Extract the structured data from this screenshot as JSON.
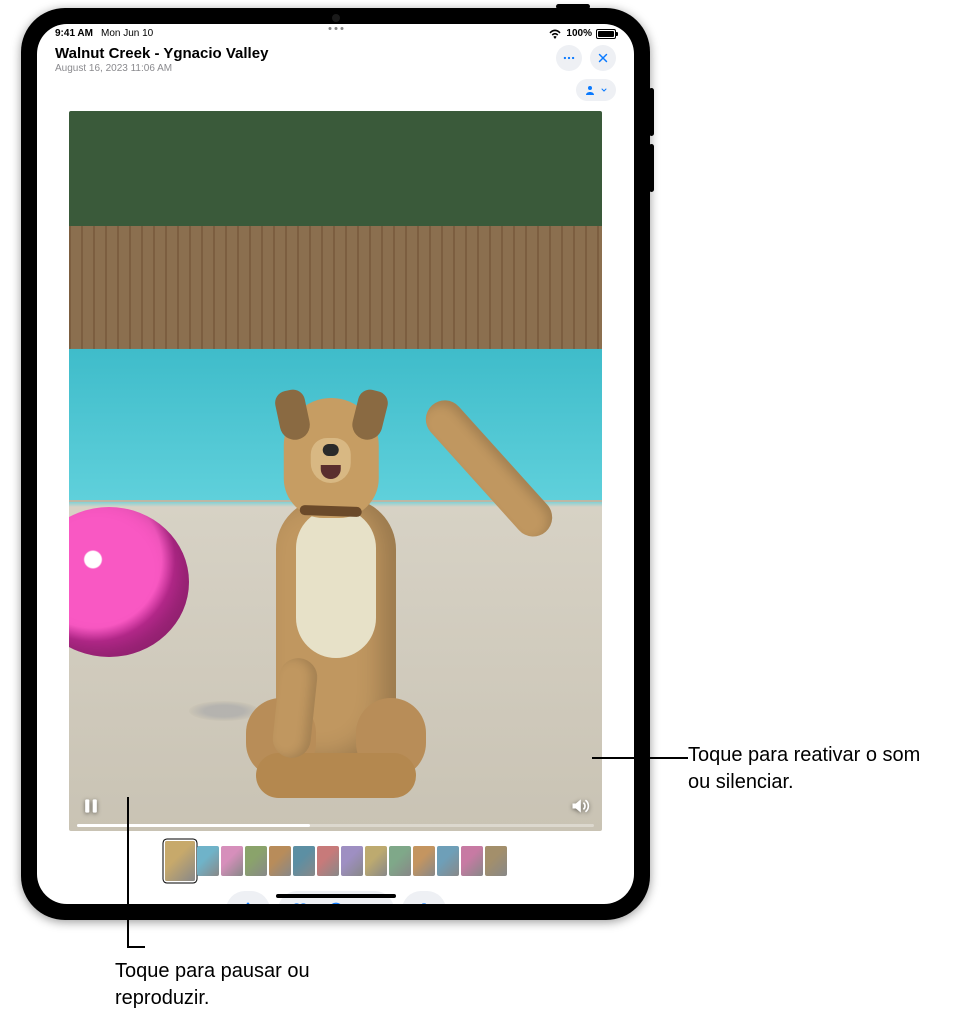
{
  "status": {
    "time": "9:41 AM",
    "date": "Mon Jun 10",
    "battery_text": "100%"
  },
  "header": {
    "title": "Walnut Creek - Ygnacio Valley",
    "subtitle": "August 16, 2023  11:06 AM"
  },
  "callouts": {
    "mute": "Toque para reativar o som ou silenciar.",
    "playpause": "Toque para pausar ou reproduzir."
  },
  "video": {
    "progress_pct": 45
  },
  "thumbnails": {
    "count": 14,
    "selected_index": 0
  }
}
